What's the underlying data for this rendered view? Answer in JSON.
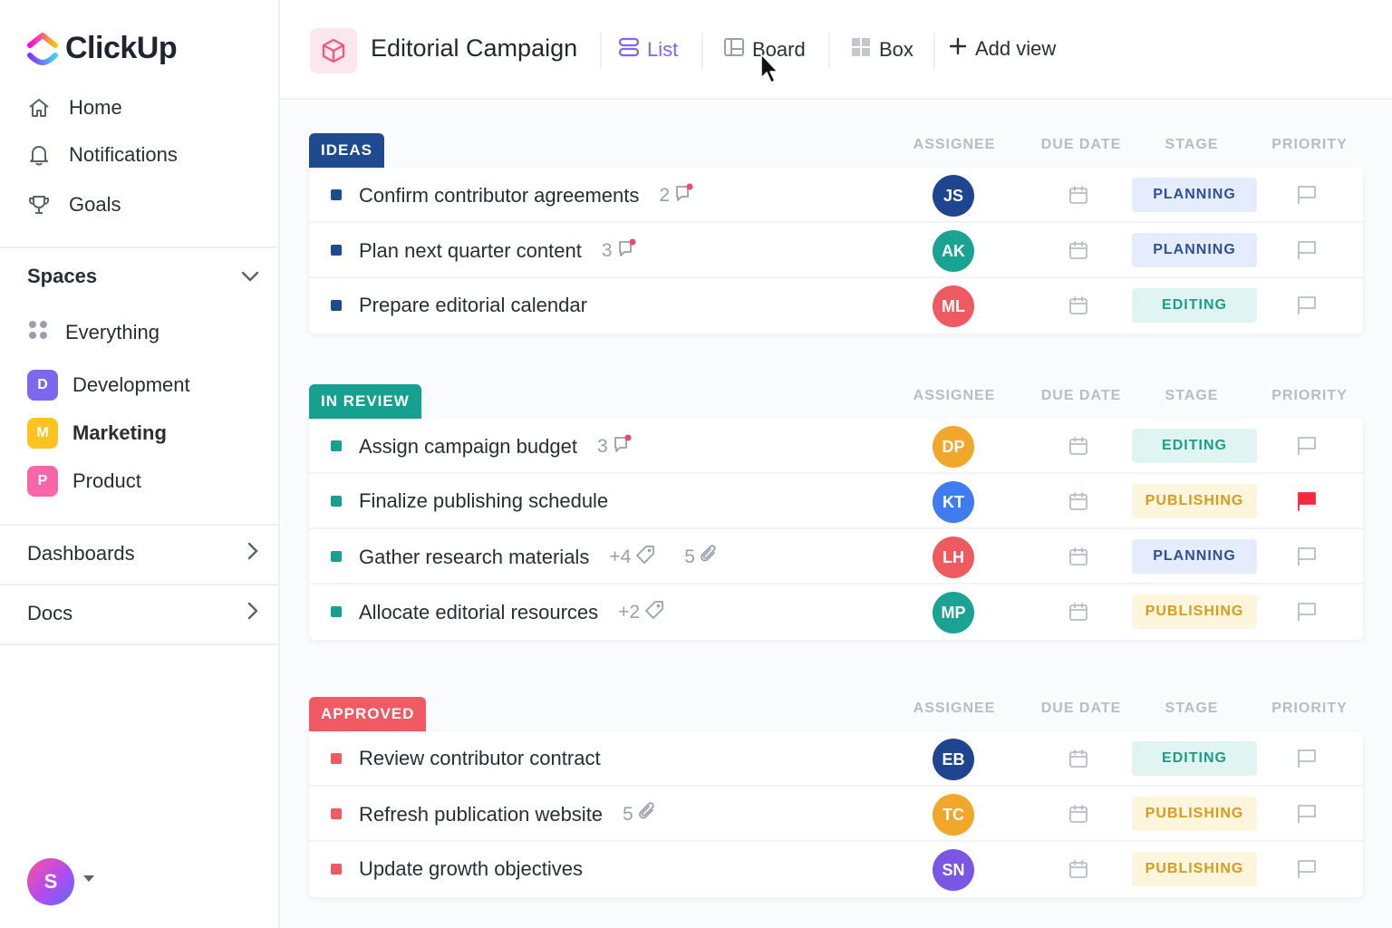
{
  "brand": {
    "name": "ClickUp"
  },
  "sidebar": {
    "nav": [
      {
        "label": "Home",
        "icon": "home-icon"
      },
      {
        "label": "Notifications",
        "icon": "bell-icon"
      },
      {
        "label": "Goals",
        "icon": "trophy-icon"
      }
    ],
    "spaces_label": "Spaces",
    "everything_label": "Everything",
    "spaces": [
      {
        "letter": "D",
        "label": "Development",
        "color": "#7b68ee",
        "active": false
      },
      {
        "letter": "M",
        "label": "Marketing",
        "color": "#ffc31f",
        "active": true
      },
      {
        "letter": "P",
        "label": "Product",
        "color": "#f766a8",
        "active": false
      }
    ],
    "dashboards_label": "Dashboards",
    "docs_label": "Docs",
    "user_initial": "S"
  },
  "header": {
    "project_title": "Editorial Campaign",
    "views": [
      {
        "label": "List",
        "icon": "list-icon",
        "active": true
      },
      {
        "label": "Board",
        "icon": "board-icon",
        "active": false
      },
      {
        "label": "Box",
        "icon": "box-icon",
        "active": false
      },
      {
        "label": "Add view",
        "icon": "plus-icon",
        "active": false
      }
    ]
  },
  "columns": [
    "ASSIGNEE",
    "DUE DATE",
    "STAGE",
    "PRIORITY"
  ],
  "groups": [
    {
      "name": "IDEAS",
      "color": "#1e4b8f",
      "tasks": [
        {
          "name": "Confirm contributor agreements",
          "comments": "2",
          "assignee": "JS",
          "avatar_color": "#1f4590",
          "stage": "PLANNING",
          "stage_class": "planning",
          "flagged": false
        },
        {
          "name": "Plan next quarter content",
          "comments": "3",
          "assignee": "AK",
          "avatar_color": "#1aa393",
          "stage": "PLANNING",
          "stage_class": "planning",
          "flagged": false
        },
        {
          "name": "Prepare editorial calendar",
          "assignee": "ML",
          "avatar_color": "#ef5a60",
          "stage": "EDITING",
          "stage_class": "editing",
          "flagged": false
        }
      ]
    },
    {
      "name": "IN REVIEW",
      "color": "#16a090",
      "tasks": [
        {
          "name": "Assign campaign budget",
          "comments": "3",
          "assignee": "DP",
          "avatar_color": "#f0a72a",
          "stage": "EDITING",
          "stage_class": "editing",
          "flagged": false
        },
        {
          "name": "Finalize publishing schedule",
          "assignee": "KT",
          "avatar_color": "#3f7cf0",
          "stage": "PUBLISHING",
          "stage_class": "publishing",
          "flagged": true
        },
        {
          "name": "Gather research materials",
          "tags": "+4",
          "attachments": "5",
          "assignee": "LH",
          "avatar_color": "#ef5a60",
          "stage": "PLANNING",
          "stage_class": "planning",
          "flagged": false
        },
        {
          "name": "Allocate editorial resources",
          "tags": "+2",
          "assignee": "MP",
          "avatar_color": "#1aa393",
          "stage": "PUBLISHING",
          "stage_class": "publishing",
          "flagged": false
        }
      ]
    },
    {
      "name": "APPROVED",
      "color": "#ef5a63",
      "tasks": [
        {
          "name": "Review contributor contract",
          "assignee": "EB",
          "avatar_color": "#1f4590",
          "stage": "EDITING",
          "stage_class": "editing",
          "flagged": false
        },
        {
          "name": "Refresh publication website",
          "attachments": "5",
          "assignee": "TC",
          "avatar_color": "#f0a72a",
          "stage": "PUBLISHING",
          "stage_class": "publishing",
          "flagged": false
        },
        {
          "name": "Update growth objectives",
          "assignee": "SN",
          "avatar_color": "#7b55e3",
          "stage": "PUBLISHING",
          "stage_class": "publishing",
          "flagged": false
        }
      ]
    }
  ]
}
